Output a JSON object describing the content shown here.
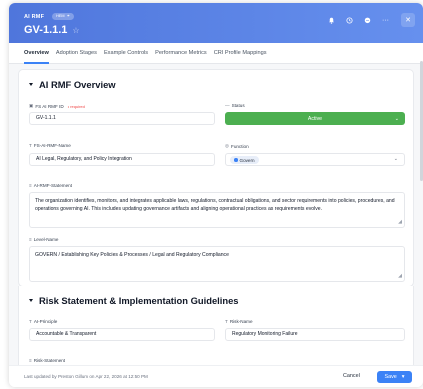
{
  "header": {
    "app_name": "AI RMF",
    "app_pill": "HEM",
    "title": "GV-1.1.1",
    "icons": [
      "bell-icon",
      "clock-icon",
      "chat-icon",
      "more-icon",
      "close-icon"
    ],
    "accent": "#4f76dc"
  },
  "tabs": [
    {
      "label": "Overview",
      "active": true
    },
    {
      "label": "Adoption Stages",
      "active": false
    },
    {
      "label": "Example Controls",
      "active": false
    },
    {
      "label": "Performance Metrics",
      "active": false
    },
    {
      "label": "CRI Profile Mappings",
      "active": false
    }
  ],
  "overview": {
    "title": "AI RMF Overview",
    "fields": {
      "id_label": "FS AI RMF ID",
      "id_required": "• required",
      "id_value": "GV-1.1.1",
      "status_label": "Status",
      "status_value": "Active",
      "name_label": "FS-AI-RMF-Name",
      "name_value": "AI Legal, Regulatory, and Policy Integration",
      "function_label": "Function",
      "function_value": "Govern",
      "statement_label": "AI-RMF-Statement",
      "statement_value": "The organization identifies, monitors, and integrates applicable laws, regulations, contractual obligations, and sector requirements into policies, procedures, and operations governing AI. This includes updating governance artifacts and aligning operational practices as requirements evolve.",
      "level_label": "Level-Name",
      "level_value": "GOVERN / Establishing Key Policies & Processes / Legal and Regulatory Compliance"
    }
  },
  "risk": {
    "title": "Risk Statement & Implementation Guidelines",
    "principle_label": "AI-Principle",
    "principle_value": "Accountable & Transparent",
    "risk_name_label": "Risk-Name",
    "risk_name_value": "Regulatory Monitoring Failure",
    "statement_label": "Risk-Statement"
  },
  "footer": {
    "updated_text": "Last updated by Preston Gillum on Apr 22, 2026 at 12:50 PM",
    "cancel_label": "Cancel",
    "save_label": "Save"
  },
  "colors": {
    "status_active": "#4caf50",
    "primary": "#3b82f6"
  }
}
